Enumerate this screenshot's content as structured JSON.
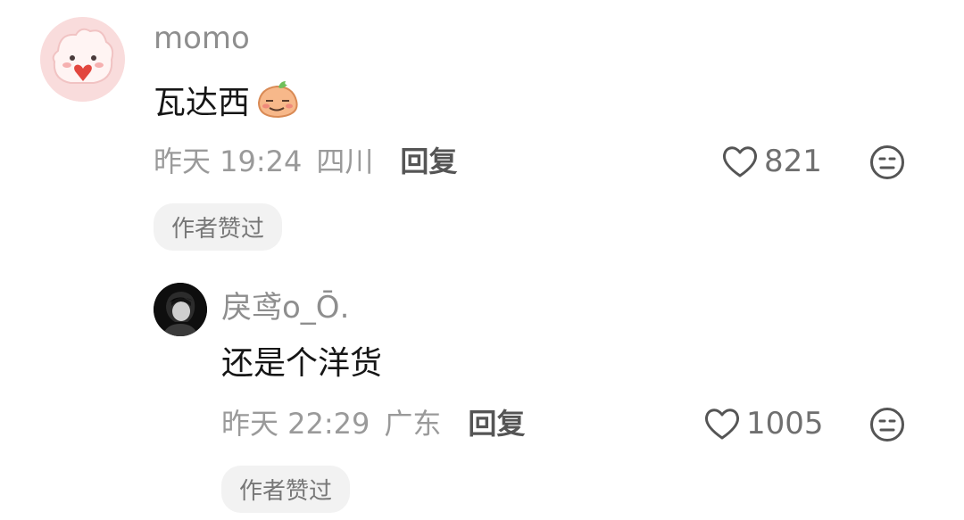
{
  "comment": {
    "username": "momo",
    "text": "瓦达西",
    "inline_emoji_icon": "carrot-shy-emoji-icon",
    "time": "昨天 19:24",
    "region": "四川",
    "reply_label": "回复",
    "likes": "821",
    "badge": "作者赞过"
  },
  "reply": {
    "username": "戾鸢o_Ō.",
    "text": "还是个洋货",
    "time": "昨天 22:29",
    "region": "广东",
    "reply_label": "回复",
    "likes": "1005",
    "badge": "作者赞过"
  },
  "icons": {
    "like": "heart-outline-icon",
    "dislike": "meh-face-icon"
  },
  "colors": {
    "username": "#8e8e8e",
    "text": "#161616",
    "meta": "#9a9a9a",
    "badge_bg": "#f2f2f2"
  }
}
